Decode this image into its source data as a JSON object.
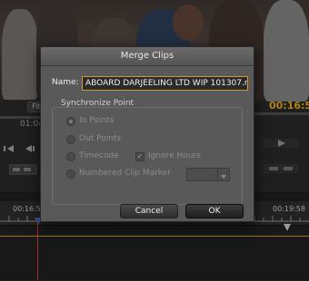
{
  "app": {
    "fit_label": "Fit",
    "source_timecode_partial": "01:04",
    "program_timecode_partial": "00:16:5",
    "timeline_left_timecode": "00:16:5",
    "timeline_right_timecode": "00:19:58",
    "accent_color": "#d9a21b"
  },
  "dialog": {
    "title": "Merge Clips",
    "name_label": "Name:",
    "name_value": "ABOARD DARJEELING LTD WIP 101307.r",
    "sync_group_label": "Synchronize Point",
    "options": {
      "in_points": "In Points",
      "out_points": "Out Points",
      "timecode": "Timecode",
      "ignore_hours": "Ignore Hours",
      "numbered_marker": "Numbered Clip Marker"
    },
    "selected_option": "In Points",
    "ignore_hours_checked": true,
    "cancel_label": "Cancel",
    "ok_label": "OK"
  }
}
